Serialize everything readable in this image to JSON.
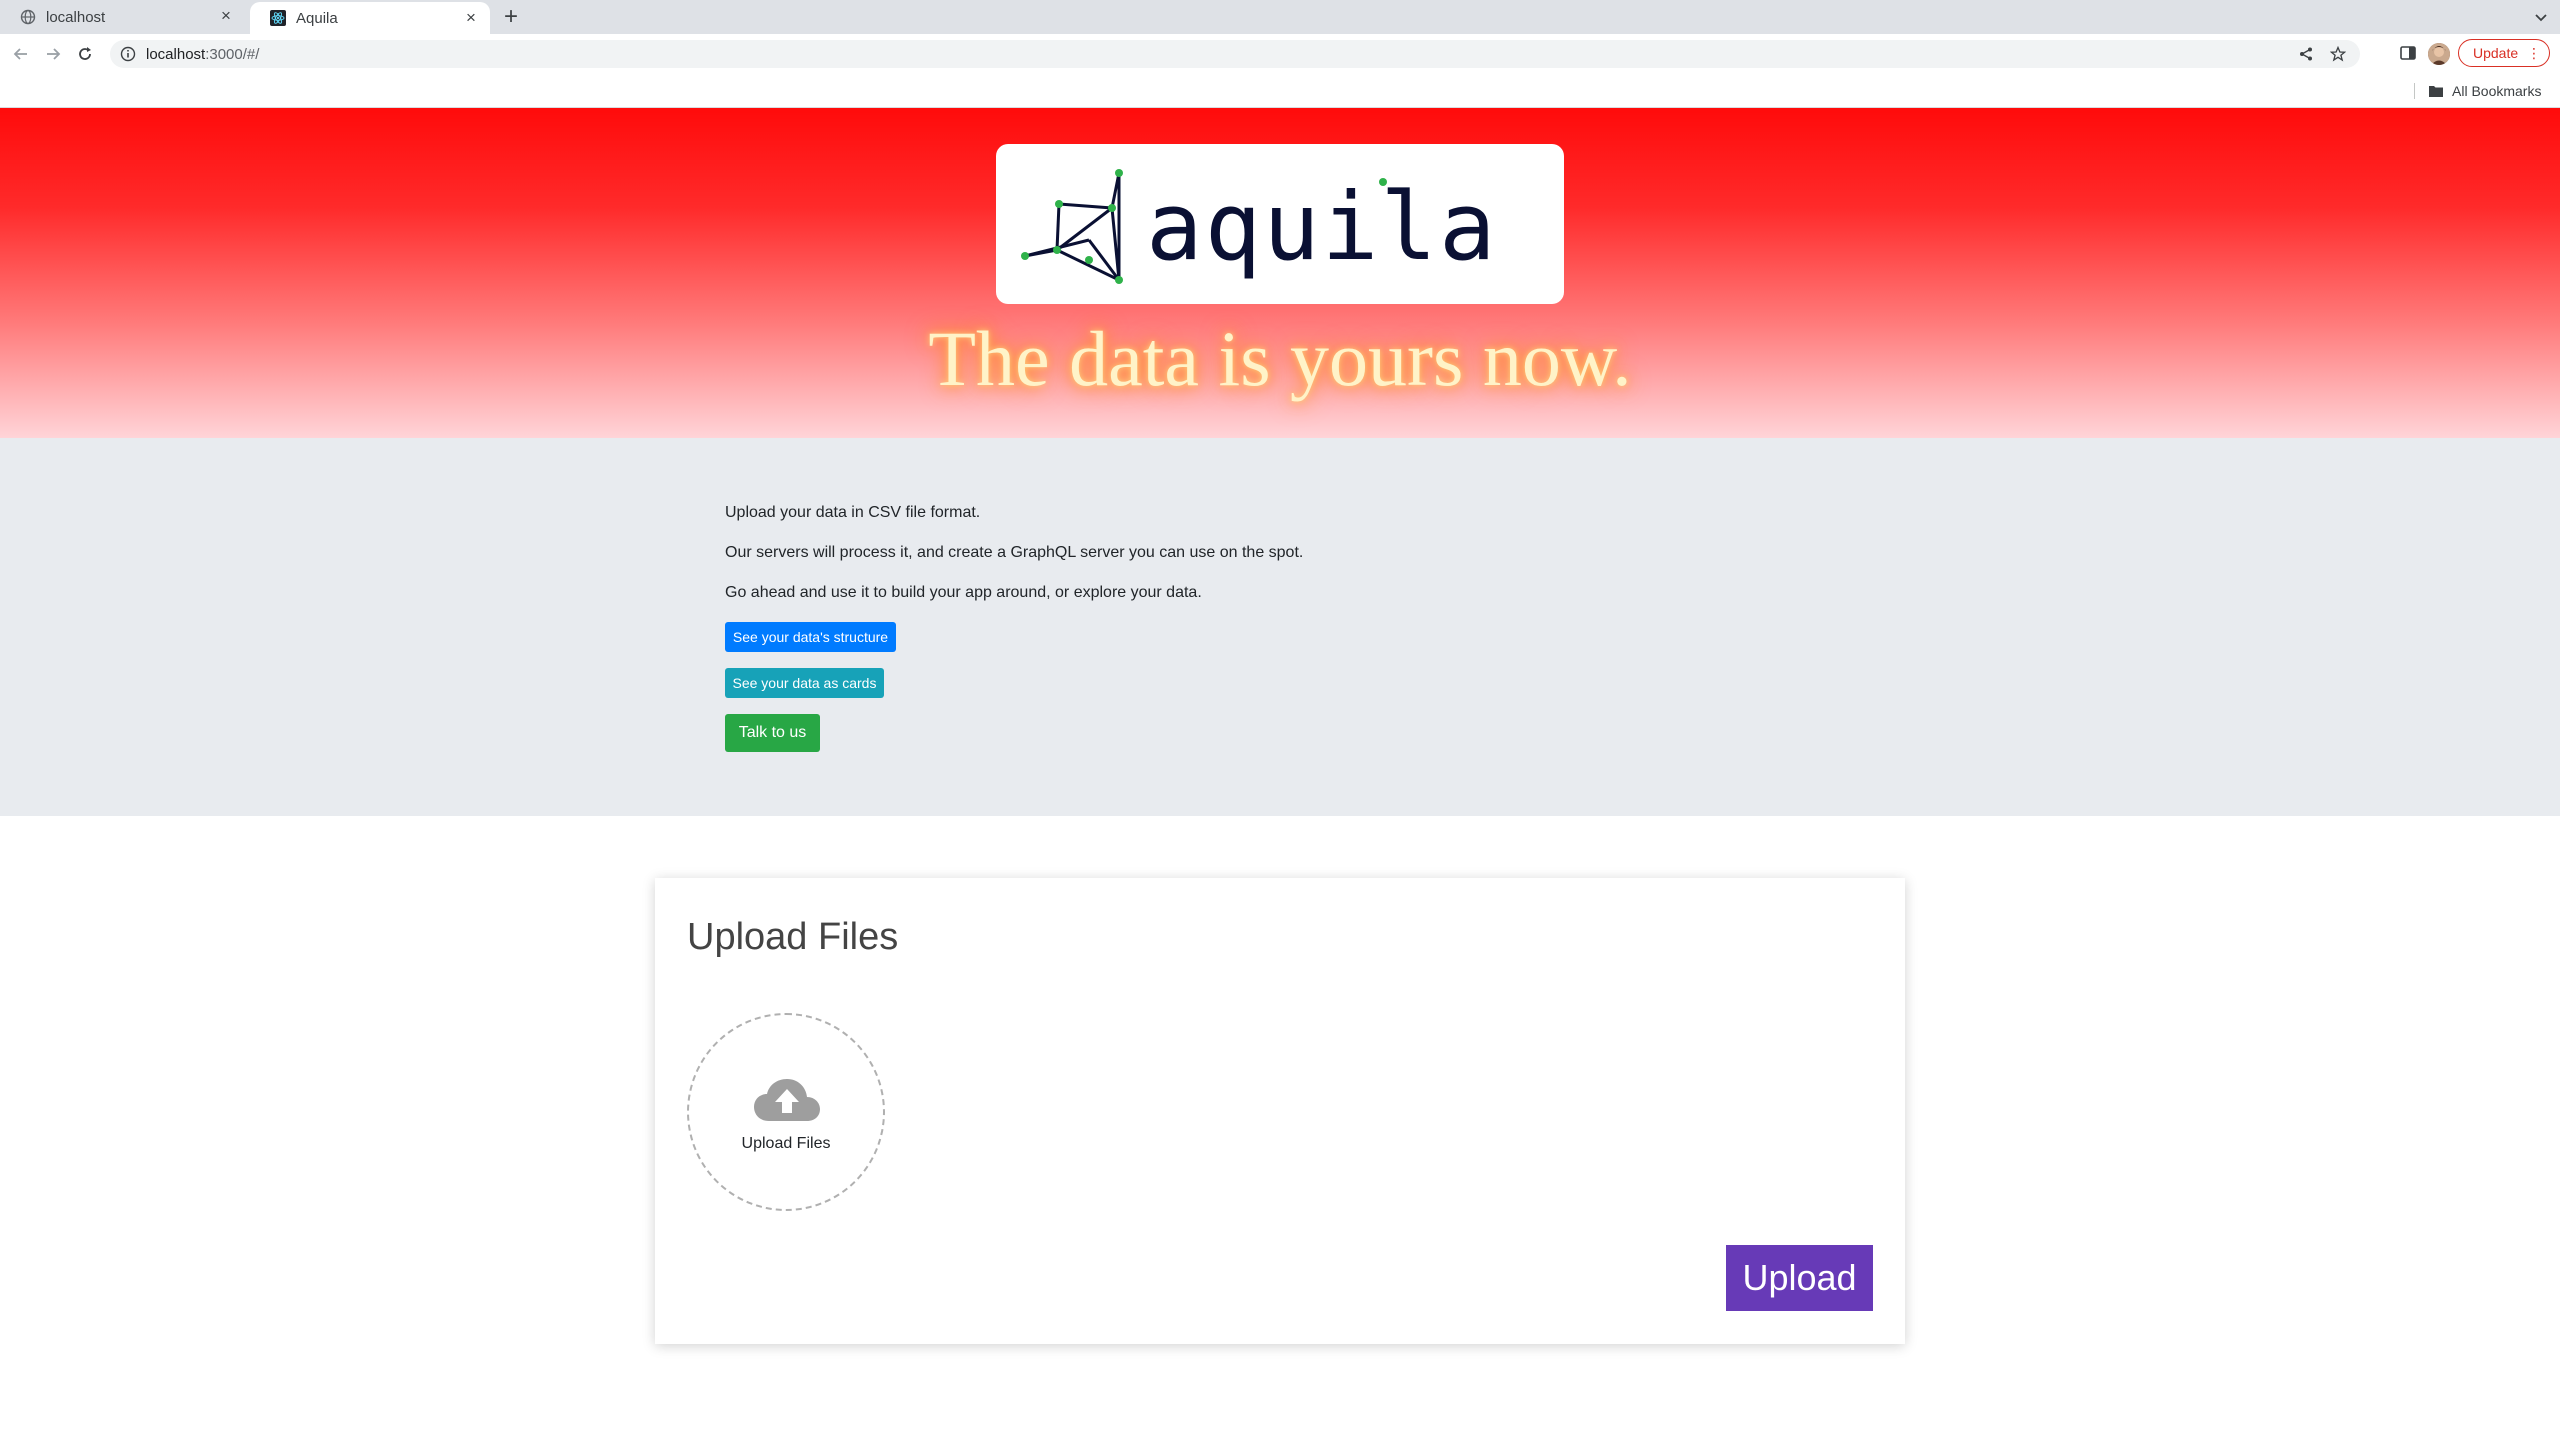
{
  "browser": {
    "tabs": [
      {
        "title": "localhost",
        "active": false
      },
      {
        "title": "Aquila",
        "active": true
      }
    ],
    "url_host": "localhost",
    "url_rest": ":3000/#/",
    "update_label": "Update",
    "bookmarks_label": "All Bookmarks"
  },
  "hero": {
    "logo_text": "aquila",
    "tagline": "The data is yours now."
  },
  "intro": {
    "line1": "Upload your data in CSV file format.",
    "line2": "Our servers will process it, and create a GraphQL server you can use on the spot.",
    "line3": "Go ahead and use it to build your app around, or explore your data.",
    "structure_button": "See your data's structure",
    "cards_button": "See your data as cards",
    "talk_button": "Talk to us"
  },
  "upload": {
    "title": "Upload Files",
    "dropzone_label": "Upload Files",
    "upload_button": "Upload"
  },
  "colors": {
    "structure_button": "#007bff",
    "cards_button": "#17a2b8",
    "talk_button": "#28a745",
    "upload_button": "#673ab7",
    "hero_top": "#ff0b0b"
  },
  "icons": [
    "globe-icon",
    "react-icon",
    "close-icon",
    "plus-icon",
    "chevron-down-icon",
    "back-icon",
    "forward-icon",
    "reload-icon",
    "info-icon",
    "share-icon",
    "star-icon",
    "side-panel-icon",
    "folder-icon",
    "cloud-upload-icon"
  ]
}
